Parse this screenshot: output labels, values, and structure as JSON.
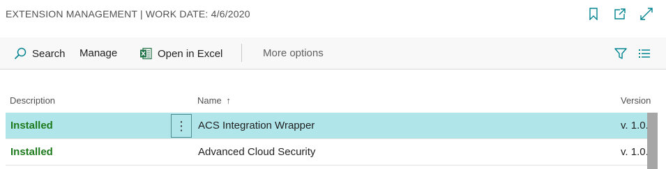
{
  "header": {
    "title": "EXTENSION MANAGEMENT | WORK DATE: 4/6/2020",
    "icons": [
      "bookmark-icon",
      "open-new-window-icon",
      "expand-icon"
    ]
  },
  "actions": {
    "search_label": "Search",
    "manage_label": "Manage",
    "excel_label": "Open in Excel",
    "more_label": "More options",
    "right_icons": [
      "filter-icon",
      "list-view-icon"
    ]
  },
  "table": {
    "columns": {
      "description": "Description",
      "name": "Name",
      "sort_indicator": "↑",
      "version": "Version"
    },
    "rows": [
      {
        "description": "Installed",
        "name": "ACS Integration Wrapper",
        "version": "v. 1.0.",
        "selected": true
      },
      {
        "description": "Installed",
        "name": "Advanced Cloud Security",
        "version": "v. 1.0.",
        "selected": false
      }
    ],
    "row_menu_glyph": "⋮"
  },
  "colors": {
    "accent": "#00838f",
    "selected_row": "#b0e5e9",
    "status_green": "#1d7a1d",
    "excel_green": "#1e7145"
  }
}
